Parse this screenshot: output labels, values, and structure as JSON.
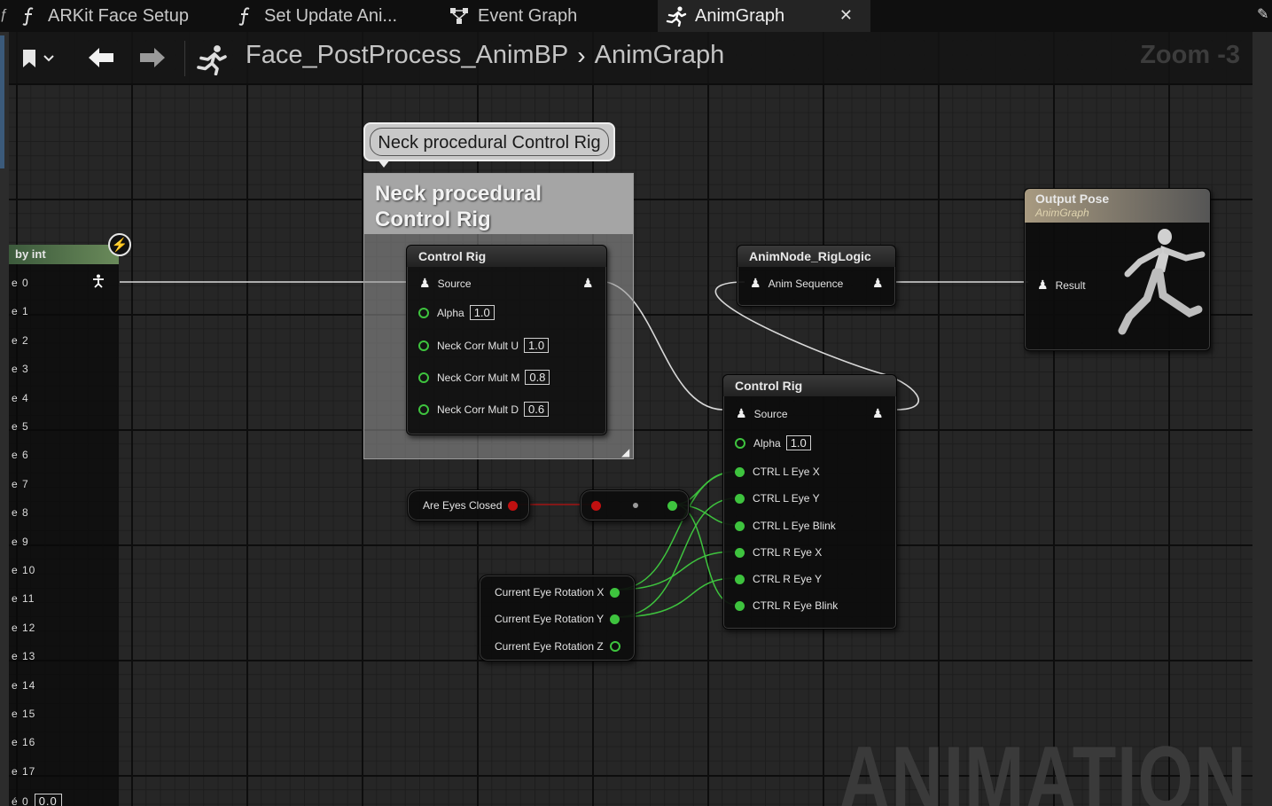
{
  "tabs": [
    {
      "label": "ARKit Face Setup",
      "icon": "function-icon",
      "active": false
    },
    {
      "label": "Set Update Ani...",
      "icon": "function-icon",
      "active": false
    },
    {
      "label": "Event Graph",
      "icon": "event-graph-icon",
      "active": false
    },
    {
      "label": "AnimGraph",
      "icon": "anim-graph-icon",
      "active": true
    }
  ],
  "breadcrumb": {
    "asset": "Face_PostProcess_AnimBP",
    "graph": "AnimGraph"
  },
  "zoom": "Zoom -3",
  "watermark": "ANIMATION",
  "switch_node": {
    "title": "by int",
    "rows": [
      "e 0",
      "e 1",
      "e 2",
      "e 3",
      "e 4",
      "e 5",
      "e 6",
      "e 7",
      "e 8",
      "e 9",
      "e 10",
      "e 11",
      "e 12",
      "e 13",
      "e 14",
      "e 15",
      "e 16",
      "e 17"
    ],
    "last_label": "é 0",
    "last_value": "0.0"
  },
  "comment": {
    "bubble": "Neck procedural Control Rig",
    "header": "Neck procedural Control Rig"
  },
  "neck_rig_node": {
    "title": "Control Rig",
    "source": "Source",
    "pins": [
      {
        "label": "Alpha",
        "value": "1.0"
      },
      {
        "label": "Neck Corr Mult U",
        "value": "1.0"
      },
      {
        "label": "Neck Corr Mult M",
        "value": "0.8"
      },
      {
        "label": "Neck Corr Mult D",
        "value": "0.6"
      }
    ]
  },
  "riglogic_node": {
    "title": "AnimNode_RigLogic",
    "pin": "Anim Sequence"
  },
  "output_node": {
    "title": "Output Pose",
    "subtitle": "AnimGraph",
    "pin": "Result"
  },
  "eye_rig_node": {
    "title": "Control Rig",
    "source": "Source",
    "alpha_label": "Alpha",
    "alpha_value": "1.0",
    "pins": [
      "CTRL L Eye X",
      "CTRL L Eye Y",
      "CTRL L Eye Blink",
      "CTRL R Eye X",
      "CTRL R Eye Y",
      "CTRL R Eye Blink"
    ]
  },
  "eyes_closed_node": {
    "label": "Are Eyes Closed"
  },
  "eye_rotation_node": {
    "pins": [
      "Current Eye Rotation X",
      "Current Eye Rotation Y",
      "Current Eye Rotation Z"
    ]
  },
  "colors": {
    "exec_green": "#3ec33e",
    "bool_red": "#b01010",
    "wire_white": "#d8d8d8"
  }
}
